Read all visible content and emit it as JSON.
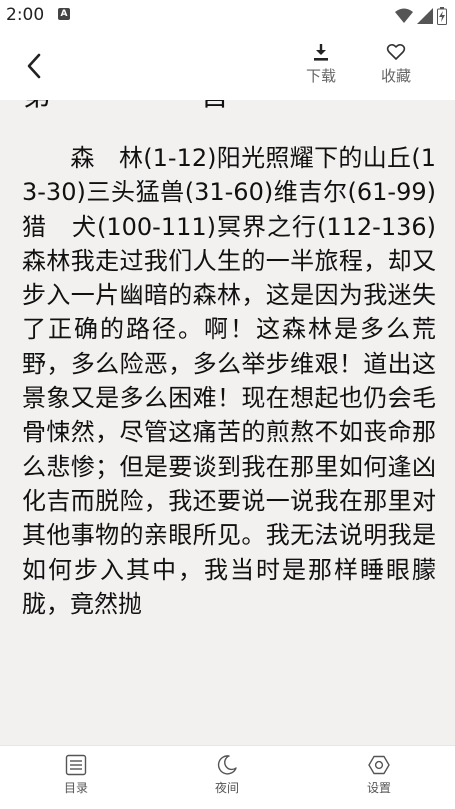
{
  "status_bar": {
    "time": "2:00",
    "notification_icon": "a-icon"
  },
  "toolbar": {
    "back_icon": "chevron-left-icon",
    "download_label": "下载",
    "favorite_label": "收藏"
  },
  "reader": {
    "chapter_heading": "第 一 首",
    "body_lead": "森　林(1-12)阳光照耀下的",
    "body_rest": "山丘(13-30)三头猛兽(31-60)维吉尔(61-99)猎　犬(100-111)冥界之行(112-136)森林我走过我们人生的一半旅程，却又步入一片幽暗的森林，这是因为我迷失了正确的路径。啊！这森林是多么荒野，多么险恶，多么举步维艰！道出这景象又是多么困难！现在想起也仍会毛骨悚然，尽管这痛苦的煎熬不如丧命那么悲惨；但是要谈到我在那里如何逢凶化吉而脱险，我还要说一说我在那里对其他事物的亲眼所见。我无法说明我是如何步入其中，我当时是那样睡眼朦胧，竟然抛"
  },
  "bottom_nav": {
    "toc_label": "目录",
    "night_label": "夜间",
    "settings_label": "设置"
  },
  "colors": {
    "reading_bg": "#f3f1f0",
    "text": "#111111",
    "icon": "#555555"
  }
}
